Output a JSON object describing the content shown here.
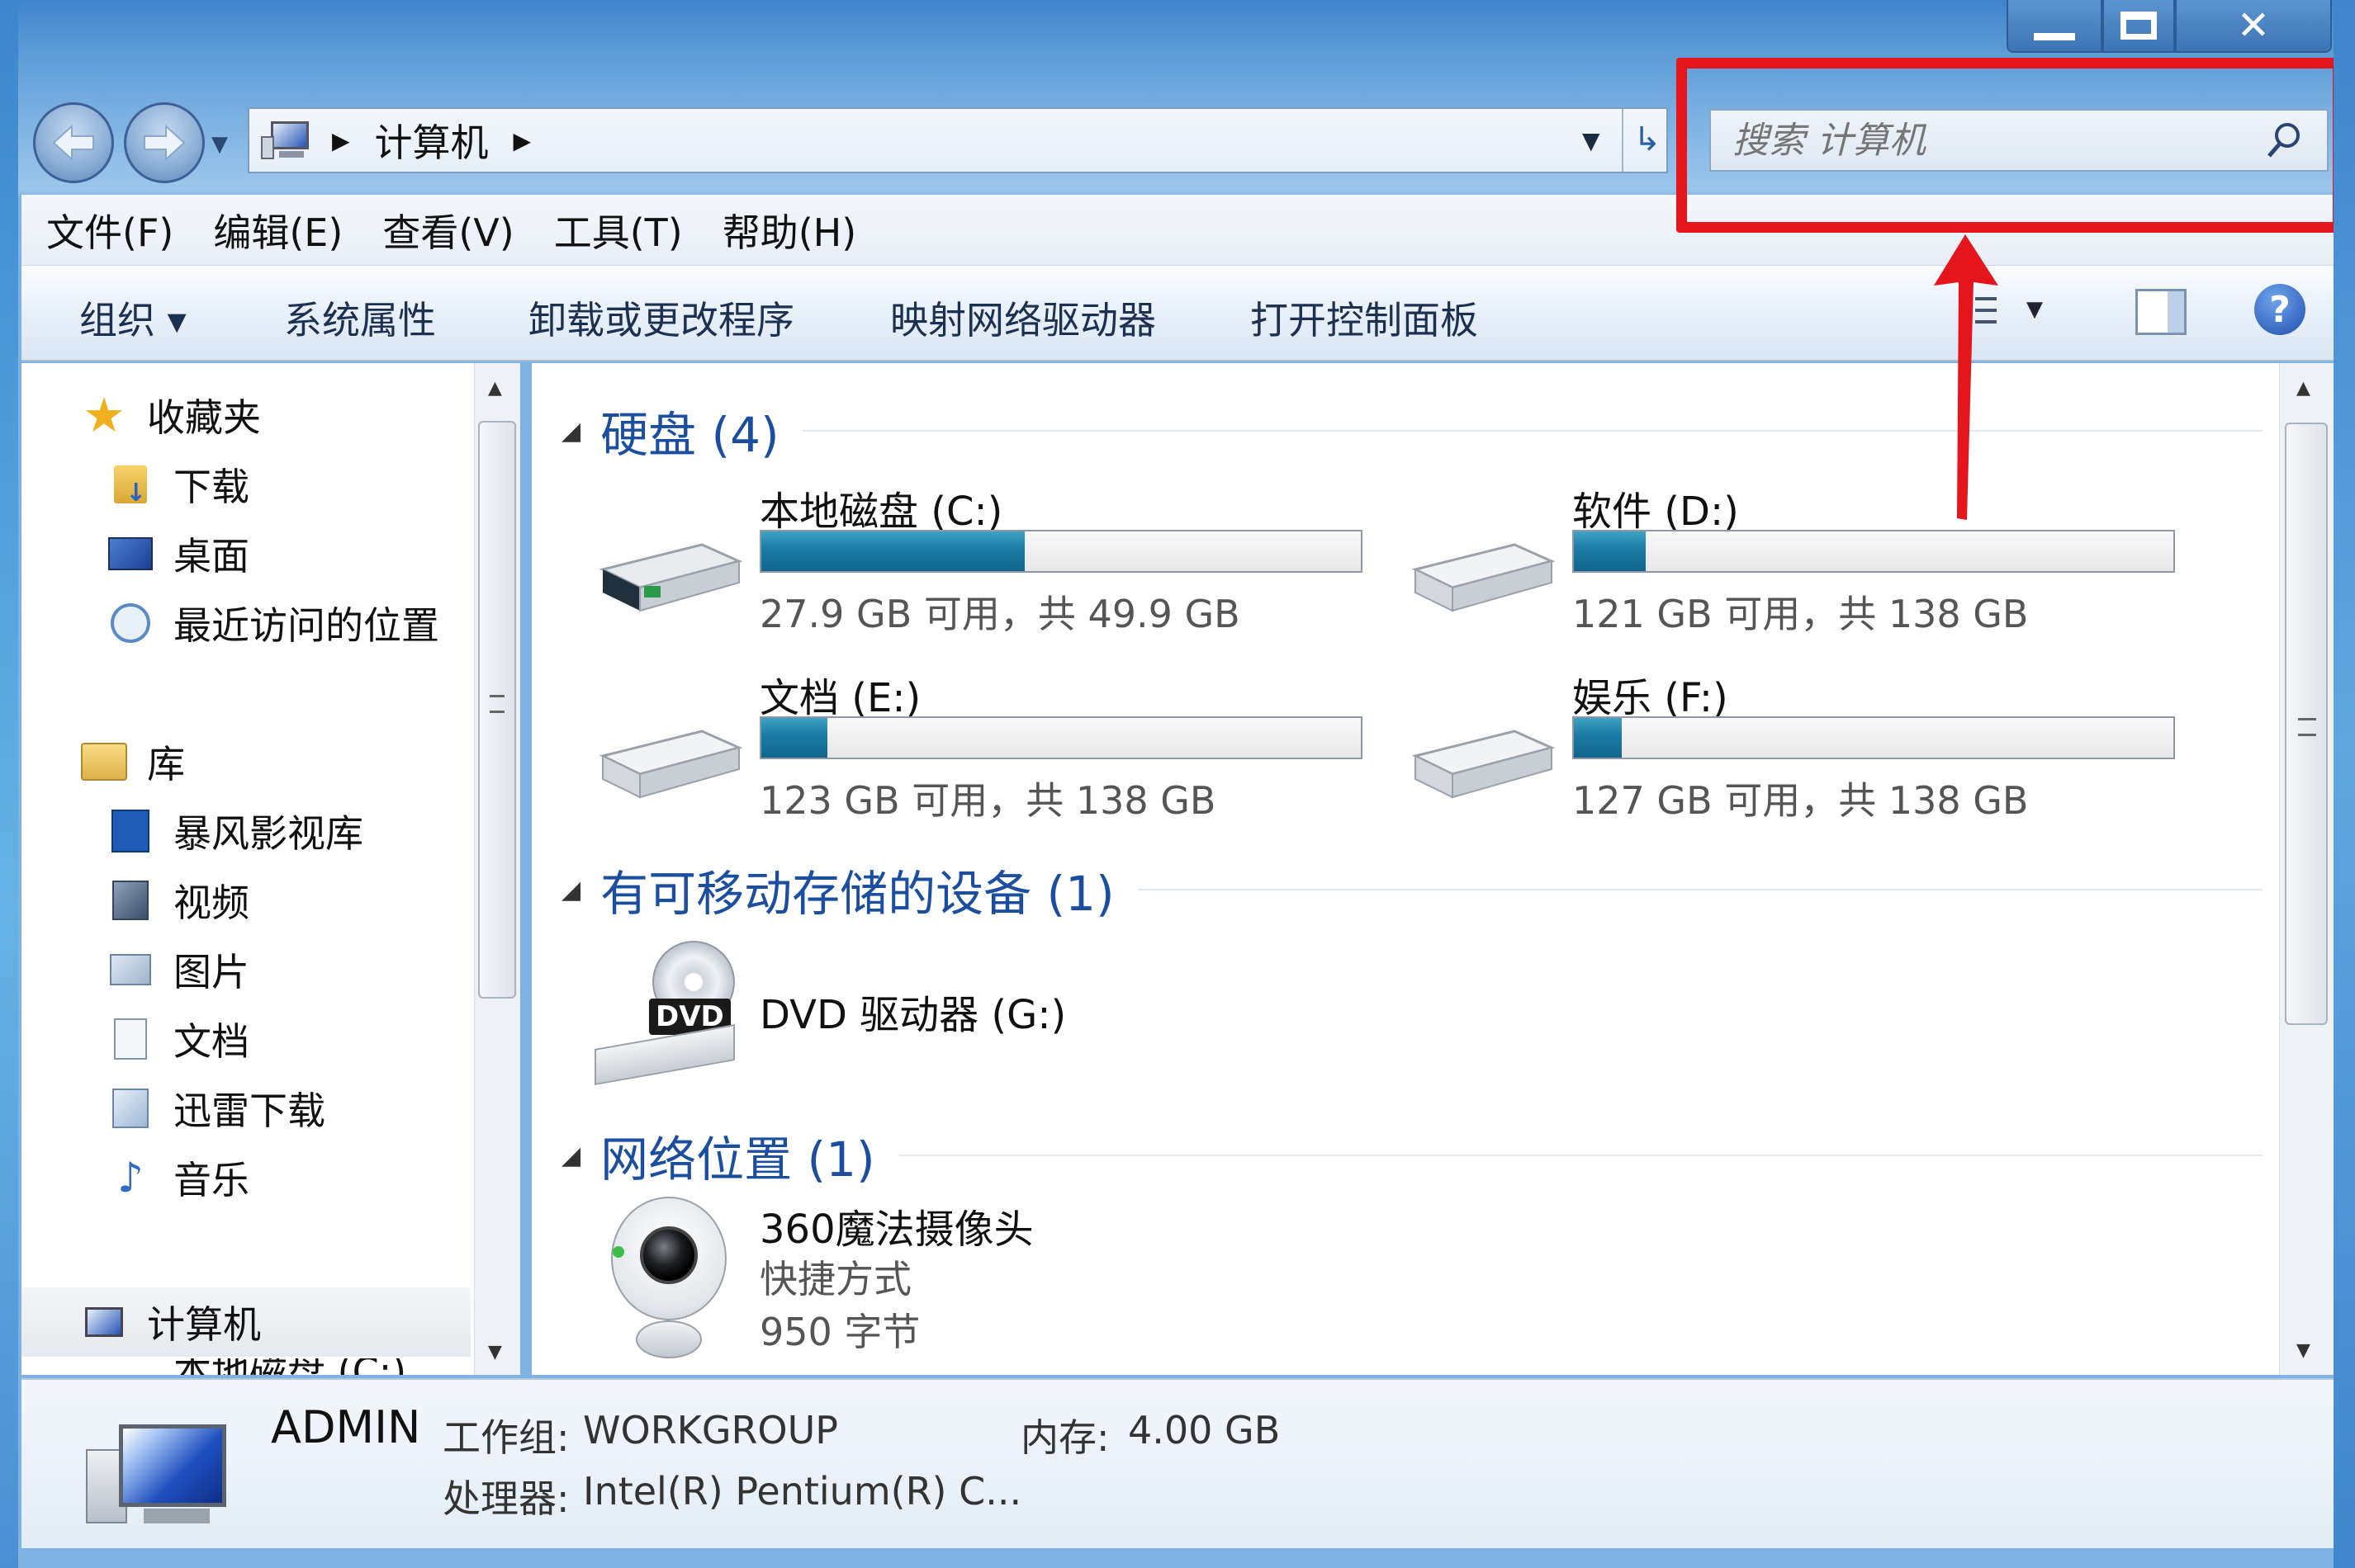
{
  "window": {
    "controls": {
      "minimize": "—",
      "maximize": "☐",
      "close": "✕"
    }
  },
  "address": {
    "crumb": "计算机"
  },
  "search": {
    "placeholder": "搜索 计算机"
  },
  "menu": [
    "文件(F)",
    "编辑(E)",
    "查看(V)",
    "工具(T)",
    "帮助(H)"
  ],
  "toolbar": {
    "organize": "组织 ▾",
    "items": [
      "系统属性",
      "卸载或更改程序",
      "映射网络驱动器",
      "打开控制面板"
    ]
  },
  "sidebar": {
    "favorites": {
      "label": "收藏夹",
      "items": [
        "下载",
        "桌面",
        "最近访问的位置"
      ]
    },
    "libraries": {
      "label": "库",
      "items": [
        "暴风影视库",
        "视频",
        "图片",
        "文档",
        "迅雷下载",
        "音乐"
      ]
    },
    "computer": {
      "label": "计算机",
      "partial_child": "本地磁盘 (C:)"
    }
  },
  "groups": {
    "hdd": {
      "title": "硬盘 (4)"
    },
    "removable": {
      "title": "有可移动存储的设备 (1)"
    },
    "network": {
      "title": "网络位置 (1)"
    }
  },
  "drives": [
    {
      "name": "本地磁盘 (C:)",
      "info": "27.9 GB 可用，共 49.9 GB",
      "used_fraction": 0.44
    },
    {
      "name": "软件 (D:)",
      "info": "121 GB 可用，共 138 GB",
      "used_fraction": 0.12
    },
    {
      "name": "文档 (E:)",
      "info": "123 GB 可用，共 138 GB",
      "used_fraction": 0.11
    },
    {
      "name": "娱乐 (F:)",
      "info": "127 GB 可用，共 138 GB",
      "used_fraction": 0.08
    }
  ],
  "dvd": {
    "name": "DVD 驱动器 (G:)",
    "badge": "DVD"
  },
  "network_item": {
    "name": "360魔法摄像头",
    "type": "快捷方式",
    "size": "950 字节"
  },
  "status": {
    "computer_name": "ADMIN",
    "workgroup_label": "工作组:",
    "workgroup": "WORKGROUP",
    "memory_label": "内存:",
    "memory": "4.00 GB",
    "processor_label": "处理器:",
    "processor": "Intel(R) Pentium(R) C..."
  },
  "colors": {
    "annotation": "#e4161c",
    "group_title": "#1c4ea0",
    "drive_fill": "#1c7ea6"
  }
}
